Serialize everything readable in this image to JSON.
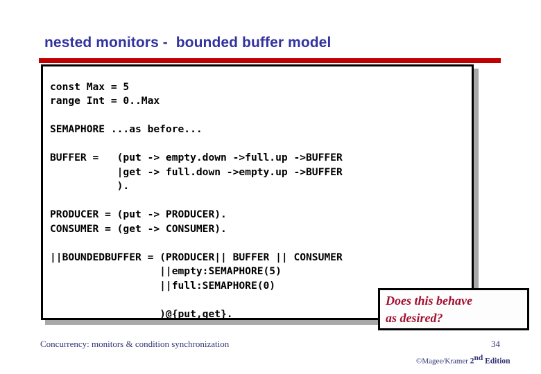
{
  "slide": {
    "title": "nested monitors -  bounded buffer model",
    "title_color": "#3333a0",
    "rule_color": "#c00000"
  },
  "code": {
    "language": "fsp",
    "text": "const Max = 5\nrange Int = 0..Max\n\nSEMAPHORE ...as before...\n\nBUFFER =   (put -> empty.down ->full.up ->BUFFER\n           |get -> full.down ->empty.up ->BUFFER\n           ).\n\nPRODUCER = (put -> PRODUCER).\nCONSUMER = (get -> CONSUMER).\n\n||BOUNDEDBUFFER = (PRODUCER|| BUFFER || CONSUMER\n                  ||empty:SEMAPHORE(5)\n                  ||full:SEMAPHORE(0)\n\n                  )@{put,get}.",
    "lines": [
      "const Max = 5",
      "range Int = 0..Max",
      "",
      "SEMAPHORE ...as before...",
      "",
      "BUFFER =   (put -> empty.down ->full.up ->BUFFER",
      "           |get -> full.down ->empty.up ->BUFFER",
      "           ).",
      "",
      "PRODUCER = (put -> PRODUCER).",
      "CONSUMER = (get -> CONSUMER).",
      "",
      "||BOUNDEDBUFFER = (PRODUCER|| BUFFER || CONSUMER",
      "                  ||empty:SEMAPHORE(5)",
      "                  ||full:SEMAPHORE(0)",
      "",
      "                  )@{put,get}."
    ]
  },
  "callout": {
    "text": "Does this behave\nas desired?",
    "color": "#a11030"
  },
  "footer": {
    "note": "Concurrency: monitors & condition synchronization",
    "page_number": "34",
    "copyright_prefix": "©Magee/Kramer ",
    "edition_number": "2",
    "edition_ordinal": "nd",
    "edition_word": " Edition"
  }
}
